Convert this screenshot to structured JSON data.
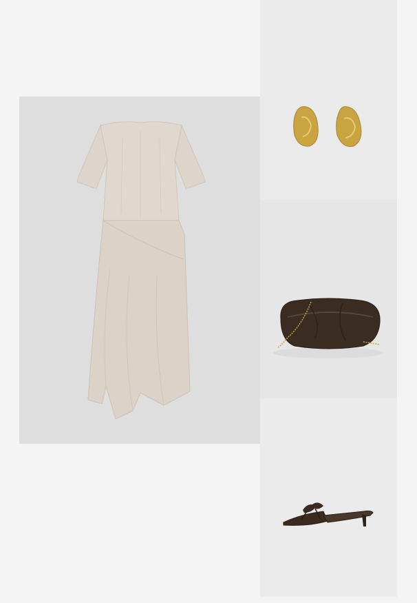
{
  "outfit": {
    "items": [
      {
        "name": "dress",
        "color": "#ddd5cb"
      },
      {
        "name": "earrings",
        "color": "#c9a440"
      },
      {
        "name": "clutch-bag",
        "color": "#3b2c22"
      },
      {
        "name": "kitten-heel-mule",
        "color": "#3a2a20"
      }
    ],
    "background": "#f4f4f4"
  }
}
